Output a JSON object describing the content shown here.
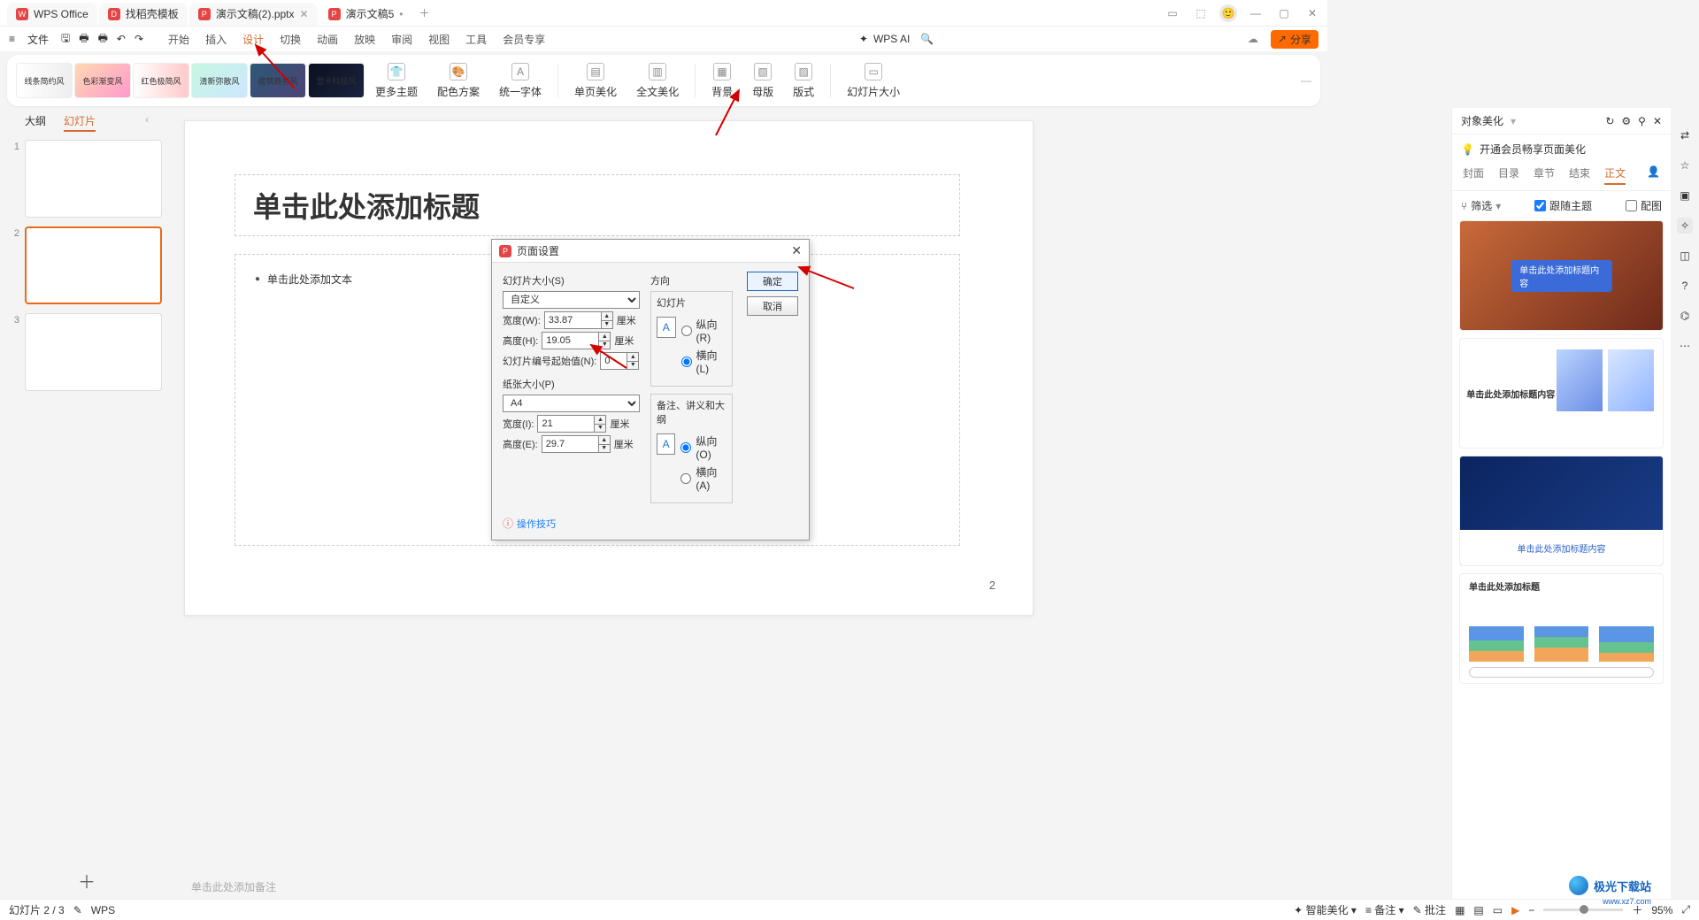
{
  "tabs": [
    {
      "icon": "W",
      "label": "WPS Office"
    },
    {
      "icon": "D",
      "label": "找稻壳模板"
    },
    {
      "icon": "P",
      "label": "演示文稿(2).pptx"
    },
    {
      "icon": "P",
      "label": "演示文稿5"
    }
  ],
  "menu": {
    "file_label": "文件",
    "items": [
      "开始",
      "插入",
      "设计",
      "切换",
      "动画",
      "放映",
      "审阅",
      "视图",
      "工具",
      "会员专享"
    ],
    "active_index": 2,
    "wpsai": "WPS AI"
  },
  "share_label": "分享",
  "ribbon": {
    "themes": [
      {
        "name": "线条简约风",
        "css": "background:linear-gradient(90deg,#fff,#eee)"
      },
      {
        "name": "色彩渐变风",
        "css": "background:linear-gradient(135deg,#ffd9b3,#ff99cc)"
      },
      {
        "name": "红色极简风",
        "css": "background:linear-gradient(90deg,#fff,#ffc9c9)"
      },
      {
        "name": "清新弥散风",
        "css": "background:linear-gradient(135deg,#c6f7e2,#cde7ff)"
      },
      {
        "name": "建筑商务风",
        "css": "background:linear-gradient(135deg,#2b5876,#4e4376);color:#fff"
      },
      {
        "name": "显卡科技风",
        "css": "background:linear-gradient(135deg,#0b1020,#1a2340);color:#fff"
      }
    ],
    "buttons": [
      "更多主题",
      "配色方案",
      "统一字体",
      "单页美化",
      "全文美化",
      "背景",
      "母版",
      "版式",
      "幻灯片大小"
    ]
  },
  "outline": {
    "tabs": [
      "大纲",
      "幻灯片"
    ],
    "active": 1,
    "slides": [
      "1",
      "2",
      "3"
    ],
    "current": 1
  },
  "slide": {
    "title_placeholder": "单击此处添加标题",
    "body_placeholder": "单击此处添加文本",
    "page_number": "2",
    "notes_placeholder": "单击此处添加备注"
  },
  "rightpanel": {
    "title": "对象美化",
    "hint": "开通会员畅享页面美化",
    "tabs": [
      "封面",
      "目录",
      "章节",
      "结束",
      "正文"
    ],
    "active": 4,
    "filter": "筛选",
    "follow_theme": "跟随主题",
    "match_color": "配图",
    "items": [
      {
        "caption": "单击此处添加标题内容",
        "style": "canyon"
      },
      {
        "caption": "单击此处添加标题内容",
        "style": "blocks"
      },
      {
        "caption": "单击此处添加标题内容",
        "style": "keyboard"
      },
      {
        "caption": "单击此处添加标题",
        "style": "charts"
      }
    ]
  },
  "dialog": {
    "title": "页面设置",
    "slide_size_label": "幻灯片大小(S)",
    "slide_size_value": "自定义",
    "width_label": "宽度(W):",
    "width_value": "33.87",
    "width_unit": "厘米",
    "height_label": "高度(H):",
    "height_value": "19.05",
    "height_unit": "厘米",
    "start_num_label": "幻灯片编号起始值(N):",
    "start_num_value": "0",
    "paper_size_label": "纸张大小(P)",
    "paper_value": "A4",
    "paper_w_label": "宽度(I):",
    "paper_w_value": "21",
    "paper_w_unit": "厘米",
    "paper_h_label": "高度(E):",
    "paper_h_value": "29.7",
    "paper_h_unit": "厘米",
    "orient_label": "方向",
    "slide_label": "幻灯片",
    "portrait_r": "纵向(R)",
    "landscape_l": "横向(L)",
    "notes_label": "备注、讲义和大纲",
    "portrait_o": "纵向(O)",
    "landscape_a": "横向(A)",
    "ok": "确定",
    "cancel": "取消",
    "tips": "操作技巧"
  },
  "status": {
    "slide": "幻灯片 2 / 3",
    "wps": "WPS",
    "smart": "智能美化",
    "notes": "备注",
    "annotate": "批注",
    "zoom": "95%"
  },
  "watermark": {
    "name": "极光下载站",
    "url": "www.xz7.com"
  }
}
